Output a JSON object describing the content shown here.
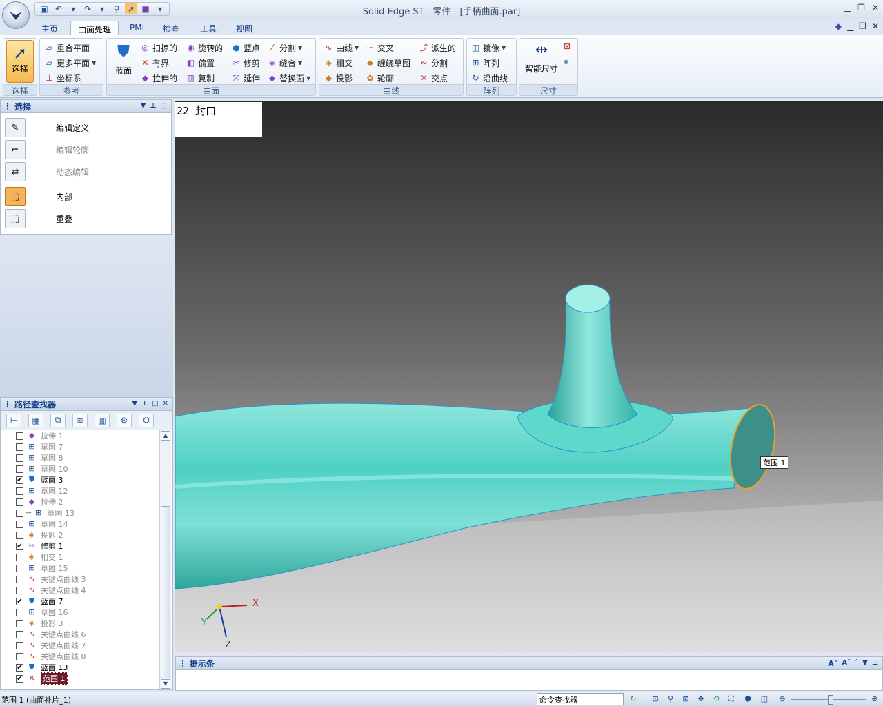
{
  "window": {
    "title": "Solid Edge ST - 零件 - [手柄曲面.par]"
  },
  "ribbon_tabs": [
    "主页",
    "曲面处理",
    "PMI",
    "检查",
    "工具",
    "视图"
  ],
  "ribbon": {
    "select_group": {
      "button": "选择",
      "title": "选择"
    },
    "reference_group": {
      "items": [
        "重合平面",
        "更多平面",
        "坐标系"
      ],
      "title": "参考"
    },
    "surface_group": {
      "bluesurf": "蓝面",
      "col1": [
        "扫掠的",
        "有界",
        "拉伸的"
      ],
      "col2": [
        "旋转的",
        "偏置",
        "复制"
      ],
      "col3": [
        "蓝点",
        "修剪",
        "延伸"
      ],
      "col4": [
        "分割",
        "缝合",
        "替换面"
      ],
      "title": "曲面"
    },
    "curve_group": {
      "col1": [
        "曲线",
        "相交",
        "投影"
      ],
      "col2": [
        "交叉",
        "缠绕草图",
        "轮廓"
      ],
      "col3": [
        "派生的",
        "分割",
        "交点"
      ],
      "title": "曲线"
    },
    "pattern_group": {
      "items": [
        "镜像",
        "阵列",
        "沿曲线"
      ],
      "title": "阵列"
    },
    "dimension_group": {
      "button": "智能尺寸",
      "title": "尺寸"
    }
  },
  "select_pane": {
    "title": "选择",
    "items": [
      {
        "label": "编辑定义",
        "enabled": true,
        "active": false
      },
      {
        "label": "编辑轮廓",
        "enabled": false,
        "active": false
      },
      {
        "label": "动态编辑",
        "enabled": false,
        "active": false
      },
      {
        "label": "内部",
        "enabled": true,
        "active": true
      },
      {
        "label": "重叠",
        "enabled": true,
        "active": false
      }
    ]
  },
  "pathfinder": {
    "title": "路径查找器",
    "rows": [
      {
        "label": "拉伸 1",
        "checked": false,
        "icon": "extrude-icon"
      },
      {
        "label": "草图 7",
        "checked": false,
        "icon": "sketch-icon"
      },
      {
        "label": "草图 8",
        "checked": false,
        "icon": "sketch-icon"
      },
      {
        "label": "草图 10",
        "checked": false,
        "icon": "sketch-icon"
      },
      {
        "label": "蓝面 3",
        "checked": true,
        "icon": "bluesurf-icon"
      },
      {
        "label": "草图 12",
        "checked": false,
        "icon": "sketch-icon"
      },
      {
        "label": "拉伸 2",
        "checked": false,
        "icon": "extrude-icon"
      },
      {
        "label": "草图 13",
        "checked": false,
        "icon": "sketch-icon",
        "indent": true
      },
      {
        "label": "草图 14",
        "checked": false,
        "icon": "sketch-icon"
      },
      {
        "label": "投影 2",
        "checked": false,
        "icon": "projection-icon"
      },
      {
        "label": "修剪 1",
        "checked": true,
        "icon": "trim-icon"
      },
      {
        "label": "相交 1",
        "checked": false,
        "icon": "intersect-icon"
      },
      {
        "label": "草图 15",
        "checked": false,
        "icon": "sketch-icon"
      },
      {
        "label": "关键点曲线 3",
        "checked": false,
        "icon": "keypoint-curve-icon"
      },
      {
        "label": "关键点曲线 4",
        "checked": false,
        "icon": "keypoint-curve-icon"
      },
      {
        "label": "蓝面 7",
        "checked": true,
        "icon": "bluesurf-icon"
      },
      {
        "label": "草图 16",
        "checked": false,
        "icon": "sketch-icon"
      },
      {
        "label": "投影 3",
        "checked": false,
        "icon": "projection-icon"
      },
      {
        "label": "关键点曲线 6",
        "checked": false,
        "icon": "keypoint-curve-icon"
      },
      {
        "label": "关键点曲线 7",
        "checked": false,
        "icon": "keypoint-curve-icon"
      },
      {
        "label": "关键点曲线 8",
        "checked": false,
        "icon": "keypoint-curve-icon"
      },
      {
        "label": "蓝面 13",
        "checked": true,
        "icon": "bluesurf-icon"
      },
      {
        "label": "范围 1",
        "checked": true,
        "icon": "bounded-icon",
        "selected": true
      }
    ]
  },
  "viewport": {
    "step_label": "22 封口",
    "range_tag": "范围 1",
    "axes": {
      "x": "X",
      "y": "Y",
      "z": "Z"
    },
    "surface_color": "#4fd0c4"
  },
  "prompt_bar": {
    "title": "提示条"
  },
  "status": {
    "text": "范围 1 (曲面补片_1)",
    "command_finder": "命令查找器"
  }
}
